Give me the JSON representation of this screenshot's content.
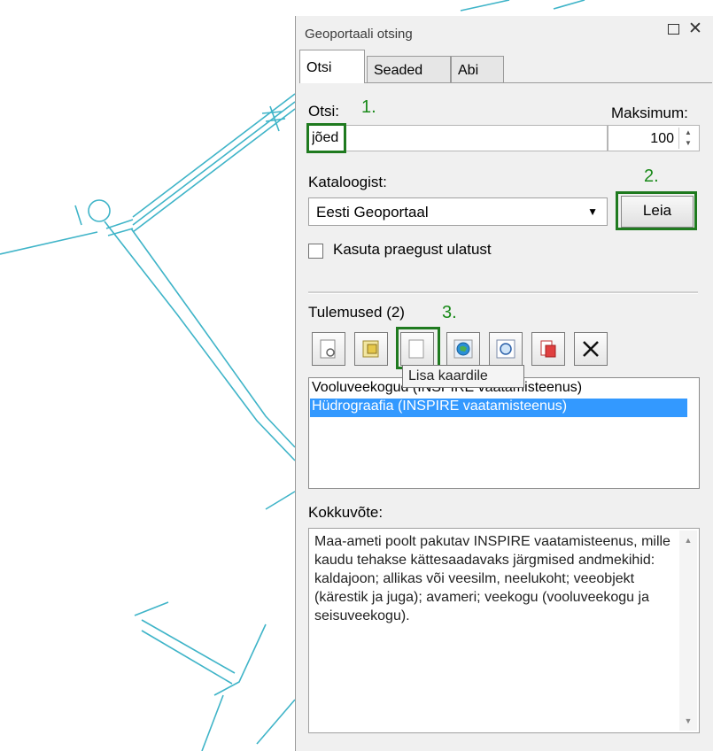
{
  "panel": {
    "title": "Geoportaali otsing",
    "float_label": "□",
    "close_label": "✕"
  },
  "tabs": [
    {
      "label": "Otsi"
    },
    {
      "label": "Seaded"
    },
    {
      "label": "Abi"
    }
  ],
  "search": {
    "label": "Otsi:",
    "value": "jõed",
    "max_label": "Maksimum:",
    "max_value": "100"
  },
  "catalog": {
    "label": "Kataloogist:",
    "value": "Eesti Geoportaal"
  },
  "find_button": "Leia",
  "extent_checkbox": {
    "label": "Kasuta praegust ulatust",
    "checked": false
  },
  "steps": [
    "1.",
    "2.",
    "3."
  ],
  "results": {
    "label": "Tulemused (2)",
    "items": [
      "Vooluveekogud (INSPIRE vaatamisteenus)",
      "Hüdrograafia (INSPIRE vaatamisteenus)"
    ],
    "selected": 1
  },
  "toolbar": {
    "tooltip": "Lisa kaardile",
    "buttons": [
      "details-icon",
      "metadata-icon",
      "add-to-map-icon",
      "globe-icon",
      "zoom-to-icon",
      "open-icon",
      "delete-icon"
    ]
  },
  "summary": {
    "label": "Kokkuvõte:",
    "text": "Maa-ameti poolt pakutav INSPIRE vaatamisteenus, mille kaudu tehakse kättesaadavaks järgmised andmekihid: kaldajoon; allikas või veesilm, neelukoht; veeobjekt (kärestik ja juga); avameri; veekogu (vooluveekogu ja seisuveekogu)."
  },
  "colors": {
    "map_lines": "#3fb4c8",
    "highlight": "#1f7a1f",
    "step_text": "#1a8a1a",
    "selection": "#3399ff"
  }
}
